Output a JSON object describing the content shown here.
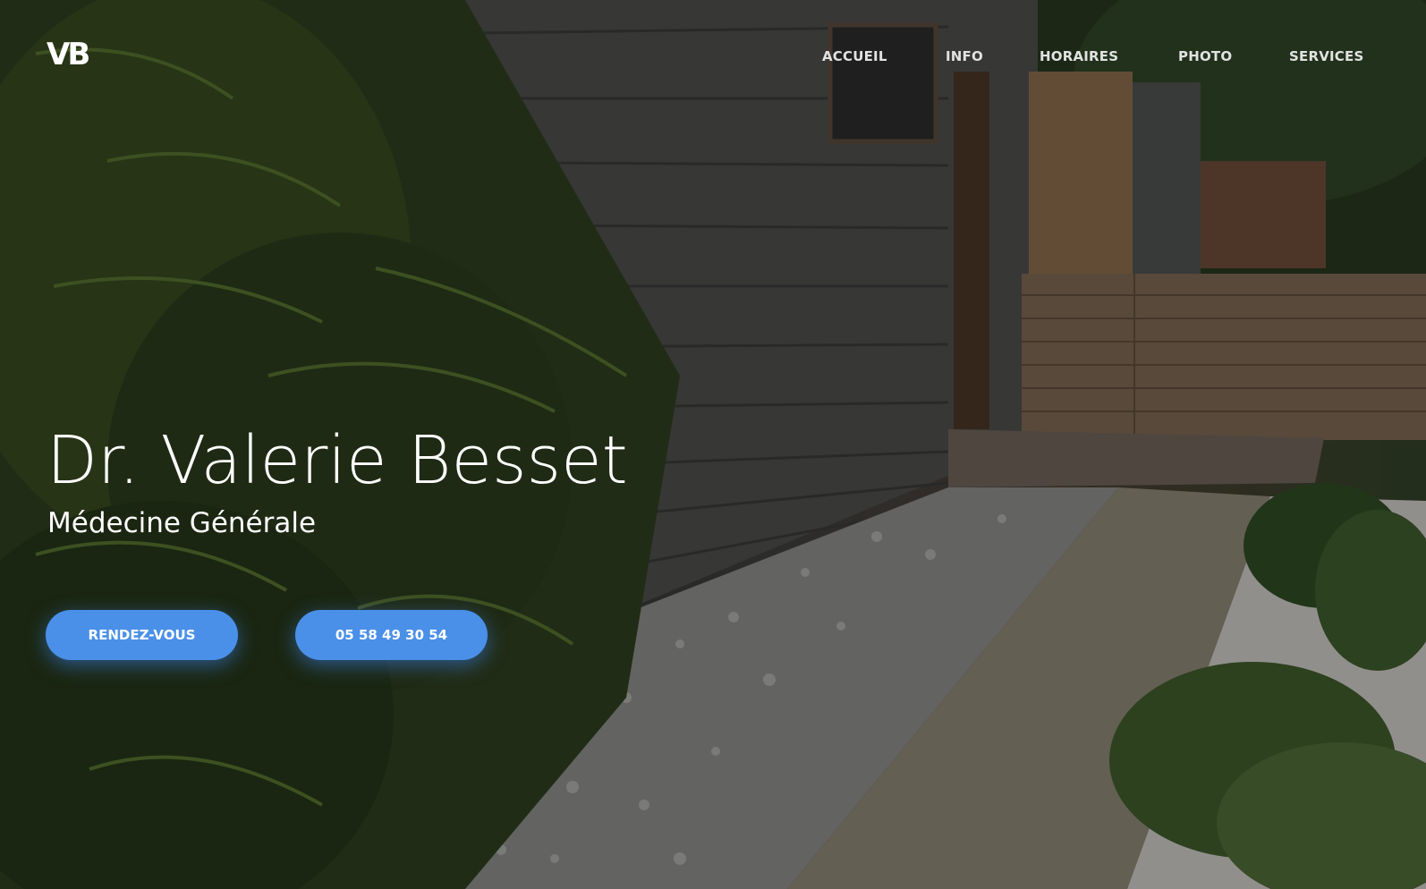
{
  "site": {
    "logo": "VB"
  },
  "nav": {
    "items": [
      {
        "label": "ACCUEIL"
      },
      {
        "label": "INFO"
      },
      {
        "label": "HORAIRES"
      },
      {
        "label": "PHOTO"
      },
      {
        "label": "SERVICES"
      }
    ]
  },
  "hero": {
    "title": "Dr. Valerie Besset",
    "subtitle": "Médecine Générale",
    "buttons": {
      "appointment_label": "RENDEZ-VOUS",
      "phone_label": "05 58 49 30 54"
    }
  },
  "colors": {
    "accent": "#4a90e8",
    "text": "#ffffff"
  }
}
